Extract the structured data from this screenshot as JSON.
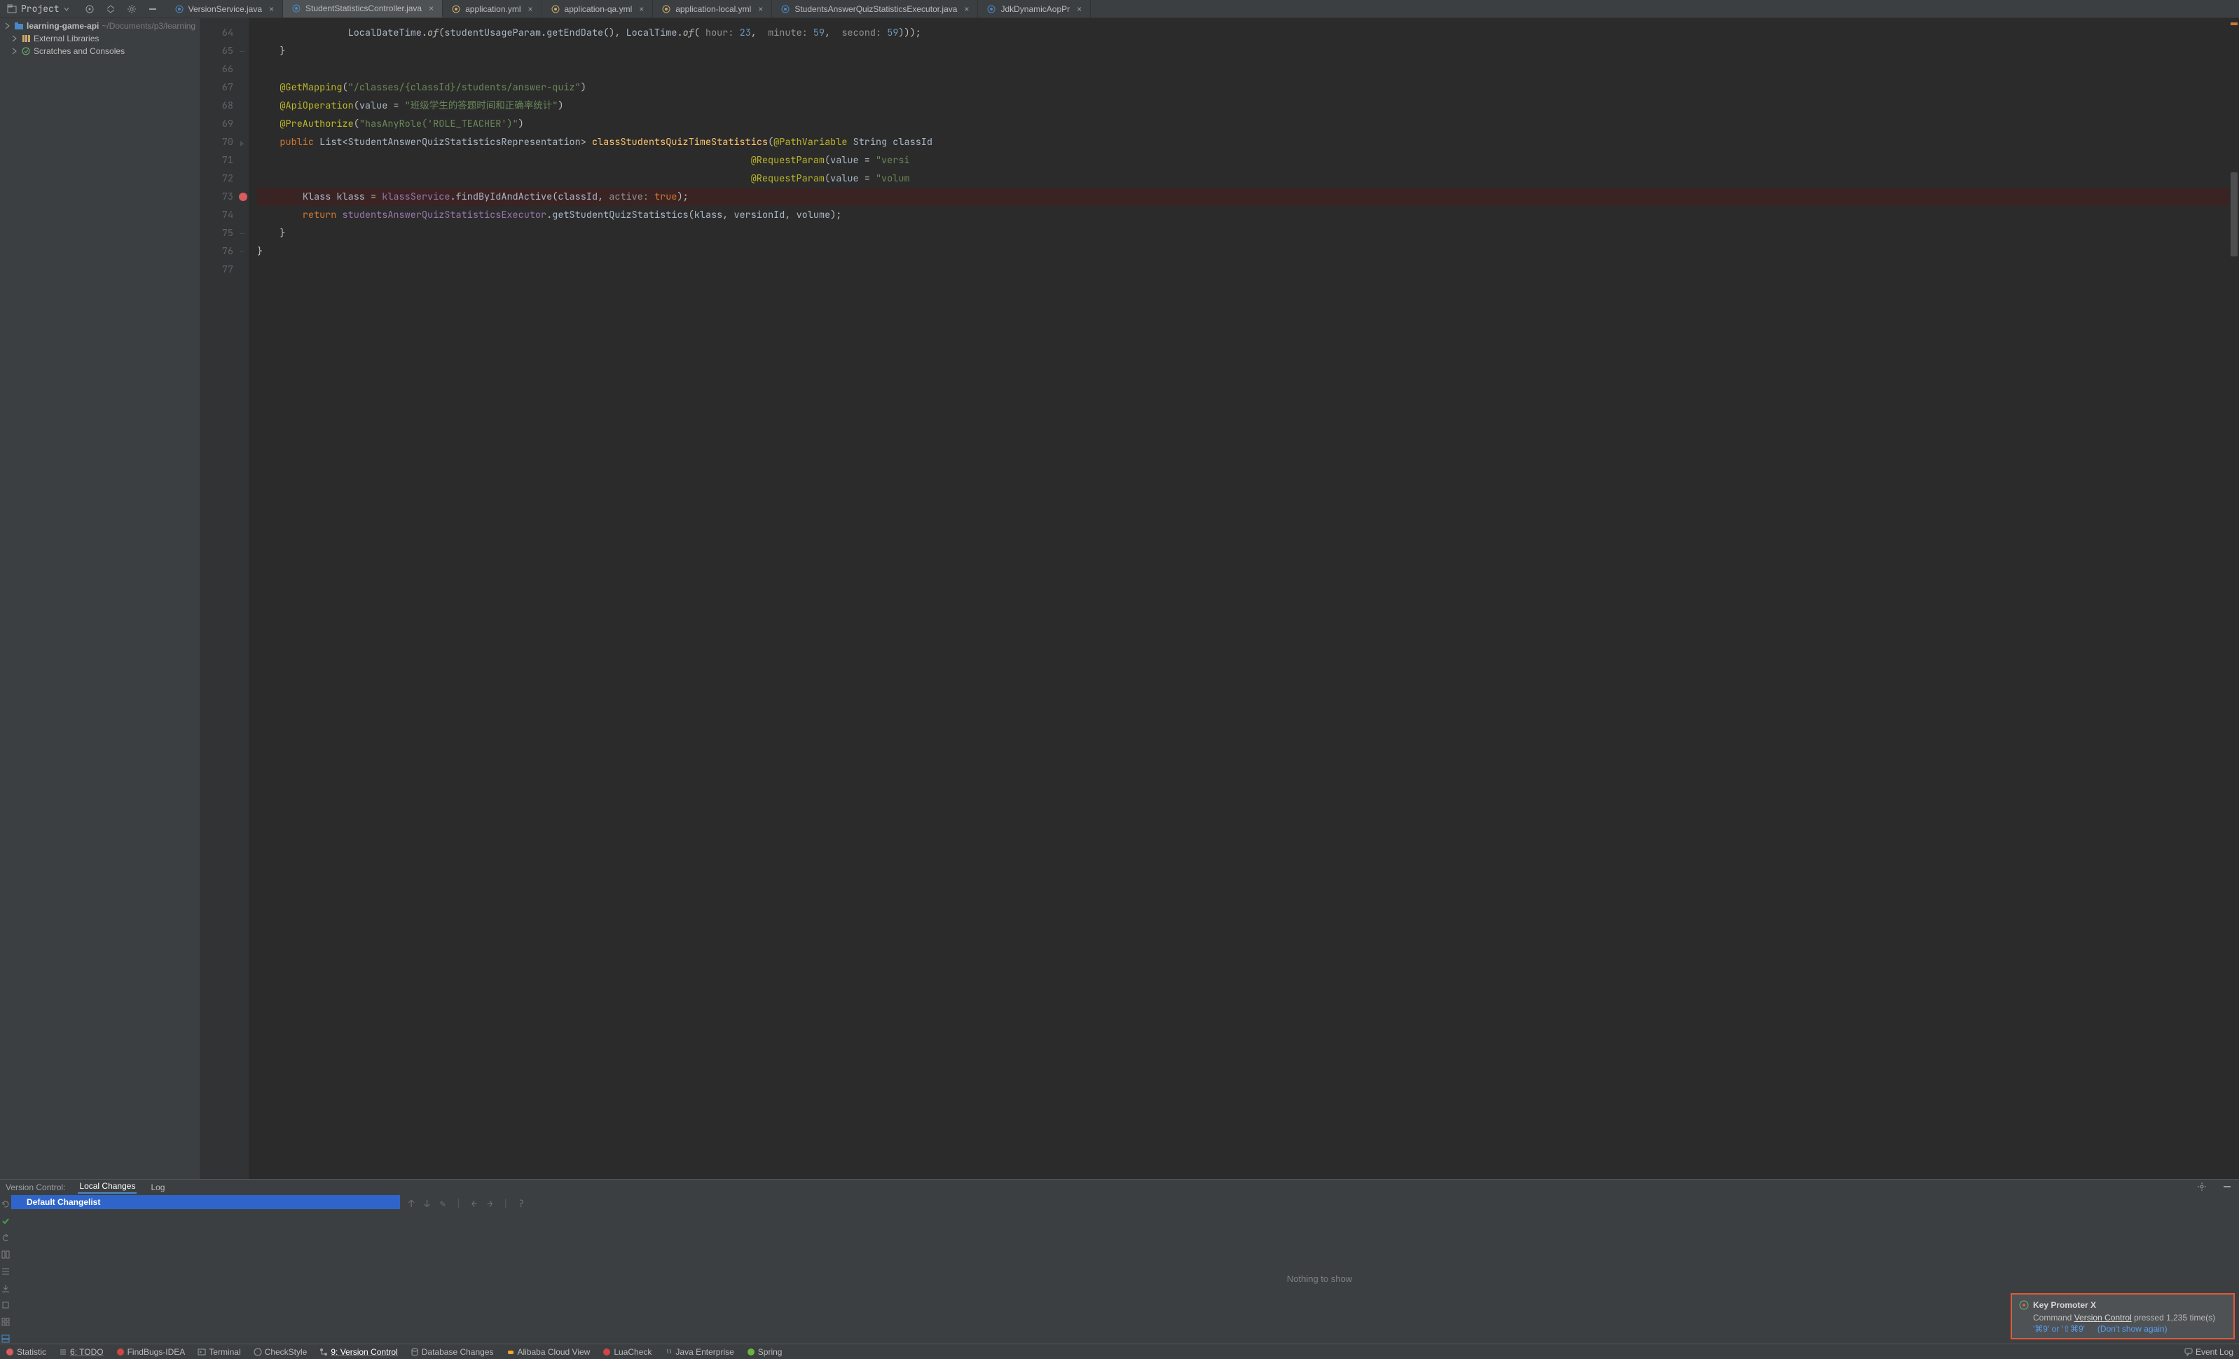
{
  "project_selector": {
    "label": "Project"
  },
  "editor_tabs": [
    {
      "label": "VersionService.java",
      "kind": "java",
      "active": false
    },
    {
      "label": "StudentStatisticsController.java",
      "kind": "java",
      "active": true
    },
    {
      "label": "application.yml",
      "kind": "yml",
      "active": false
    },
    {
      "label": "application-qa.yml",
      "kind": "yml",
      "active": false
    },
    {
      "label": "application-local.yml",
      "kind": "yml",
      "active": false
    },
    {
      "label": "StudentsAnswerQuizStatisticsExecutor.java",
      "kind": "java",
      "active": false
    },
    {
      "label": "JdkDynamicAopPr",
      "kind": "java",
      "active": false
    }
  ],
  "project_tree": {
    "root": {
      "name": "learning-game-api",
      "path": "~/Documents/p3/learning"
    },
    "items": [
      {
        "name": "External Libraries",
        "icon": "lib"
      },
      {
        "name": "Scratches and Consoles",
        "icon": "scratch"
      }
    ]
  },
  "code": {
    "first_ln": 64,
    "lines": [
      {
        "n": 64,
        "html": "                <span class='c-id'>LocalDateTime</span>.<span class='c-static'>of</span>(<span class='c-id'>studentUsageParam</span>.<span class='c-id'>getEndDate</span>(), <span class='c-id'>LocalTime</span>.<span class='c-static'>of</span>( <span class='c-param'>hour:</span> <span class='c-num'>23</span>,  <span class='c-param'>minute:</span> <span class='c-num'>59</span>,  <span class='c-param'>second:</span> <span class='c-num'>59</span>)));"
      },
      {
        "n": 65,
        "html": "    }",
        "fold_end": true
      },
      {
        "n": 66,
        "html": ""
      },
      {
        "n": 67,
        "html": "    <span class='c-ann'>@GetMapping</span>(<span class='c-str'>\"/classes/{classId}/students/answer-quiz\"</span>)"
      },
      {
        "n": 68,
        "html": "    <span class='c-ann'>@ApiOperation</span>(<span class='c-id'>value</span> = <span class='c-str'>\"班级学生的答题时间和正确率统计\"</span>)"
      },
      {
        "n": 69,
        "html": "    <span class='c-ann'>@PreAuthorize</span>(<span class='c-str'>\"hasAnyRole('ROLE_TEACHER')\"</span>)"
      },
      {
        "n": 70,
        "html": "    <span class='c-kw'>public</span> <span class='c-id'>List</span>&lt;<span class='c-id'>StudentAnswerQuizStatisticsRepresentation</span>&gt; <span class='c-mth'>classStudentsQuizTimeStatistics</span>(<span class='c-ann'>@PathVariable</span> <span class='c-id'>String classId</span>",
        "fold": true
      },
      {
        "n": 71,
        "html": "                                                                                       <span class='c-ann'>@RequestParam</span>(<span class='c-id'>value</span> = <span class='c-str'>\"versi</span>"
      },
      {
        "n": 72,
        "html": "                                                                                       <span class='c-ann'>@RequestParam</span>(<span class='c-id'>value</span> = <span class='c-str'>\"volum</span>"
      },
      {
        "n": 73,
        "html": "        <span class='c-id'>Klass klass</span> = <span class='c-fld'>klassService</span>.<span class='c-id'>findByIdAndActive</span>(<span class='c-id'>classId</span>, <span class='c-param'>active:</span> <span class='c-kw'>true</span>);",
        "bp": true
      },
      {
        "n": 74,
        "html": "        <span class='c-kw'>return</span> <span class='c-fld'>studentsAnswerQuizStatisticsExecutor</span>.<span class='c-id'>getStudentQuizStatistics</span>(<span class='c-id'>klass</span>, <span class='c-id'>versionId</span>, <span class='c-id'>volume</span>);"
      },
      {
        "n": 75,
        "html": "    }",
        "fold_end": true
      },
      {
        "n": 76,
        "html": "}",
        "fold_end": true
      },
      {
        "n": 77,
        "html": ""
      }
    ]
  },
  "vcs": {
    "title": "Version Control:",
    "tab_local": "Local Changes",
    "tab_log": "Log",
    "changelist": "Default Changelist",
    "empty": "Nothing to show",
    "help_glyph": "?"
  },
  "notification": {
    "title": "Key Promoter X",
    "body_pre": "Command ",
    "body_link": "Version Control",
    "body_post": " pressed 1,235 time(s)",
    "shortcut": "'⌘9' or '⇧⌘9'",
    "dont_show": "(Don't show again)"
  },
  "bottom_bar": {
    "items": [
      {
        "label": "Statistic",
        "icon": "stat"
      },
      {
        "label": "6: TODO",
        "icon": "todo",
        "ul": true
      },
      {
        "label": "FindBugs-IDEA",
        "icon": "bug"
      },
      {
        "label": "Terminal",
        "icon": "term"
      },
      {
        "label": "CheckStyle",
        "icon": "cs"
      },
      {
        "label": "9: Version Control",
        "icon": "git",
        "ul": true,
        "active": true
      },
      {
        "label": "Database Changes",
        "icon": "db"
      },
      {
        "label": "Alibaba Cloud View",
        "icon": "ali"
      },
      {
        "label": "LuaCheck",
        "icon": "lua"
      },
      {
        "label": "Java Enterprise",
        "icon": "jee"
      },
      {
        "label": "Spring",
        "icon": "spring"
      }
    ],
    "event_log": "Event Log"
  }
}
